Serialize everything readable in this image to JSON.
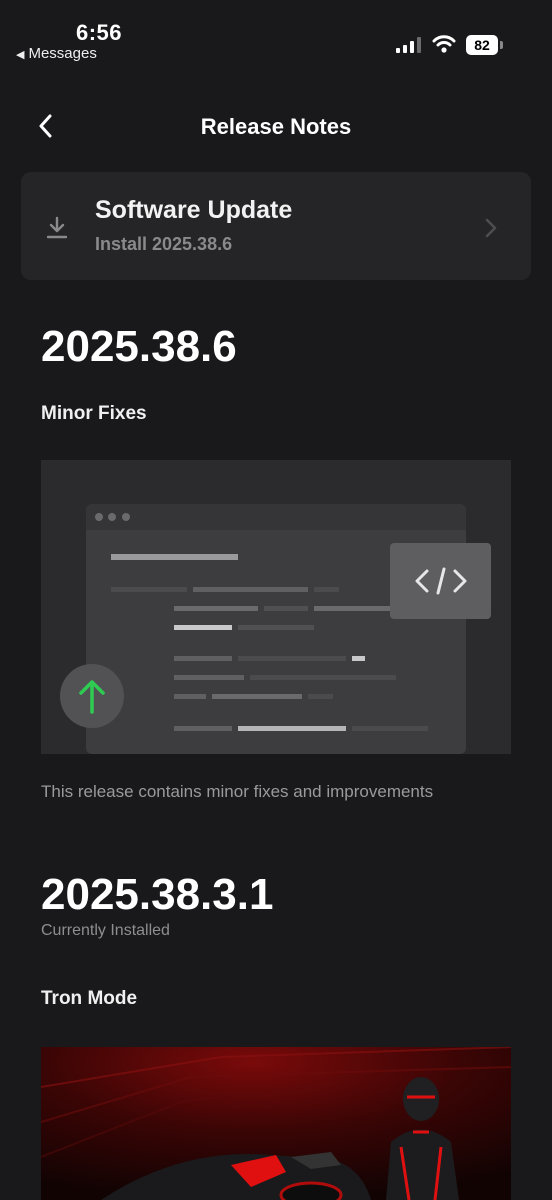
{
  "status_bar": {
    "time": "6:56",
    "back_app": "Messages",
    "battery": "82"
  },
  "nav": {
    "title": "Release Notes"
  },
  "update_card": {
    "title": "Software Update",
    "subtitle": "Install 2025.38.6"
  },
  "releases": [
    {
      "version": "2025.38.6",
      "feature": "Minor Fixes",
      "description": "This release contains minor fixes and improvements"
    },
    {
      "version": "2025.38.3.1",
      "installed_label": "Currently Installed",
      "feature": "Tron Mode"
    }
  ],
  "colors": {
    "background": "#19191b",
    "card": "#252527",
    "accent_green": "#2ecc52",
    "tron_red": "#e01010"
  },
  "icons": [
    "back-chevron-icon",
    "download-icon",
    "chevron-right-icon",
    "code-icon",
    "arrow-up-icon",
    "cellular-signal-icon",
    "wifi-icon",
    "battery-icon"
  ]
}
